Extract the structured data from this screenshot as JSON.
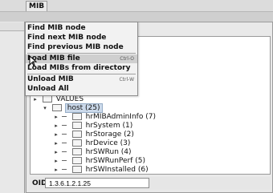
{
  "menubar": {
    "mib_label": "MIB"
  },
  "menu_items": [
    {
      "label": "Find MIB node"
    },
    {
      "label": "Find next MIB node"
    },
    {
      "label": "Find previous MIB node"
    },
    {
      "label": "Load MIB file",
      "shortcut": "Ctrl-O",
      "highlighted": true
    },
    {
      "label": "Load MIBs from directory"
    },
    {
      "label": "Unload MIB",
      "shortcut": "Ctrl-W"
    },
    {
      "label": "Unload All"
    }
  ],
  "tree": {
    "values_label": "VALUES",
    "host_label": "host (25)",
    "children": [
      "hrMIBAdminInfo (7)",
      "hrSystem (1)",
      "hrStorage (2)",
      "hrDevice (3)",
      "hrSWRun (4)",
      "hrSWRunPerf (5)",
      "hrSWInstalled (6)"
    ]
  },
  "oid": {
    "label": "OID",
    "value": "1.3.6.1.2.1.25"
  }
}
